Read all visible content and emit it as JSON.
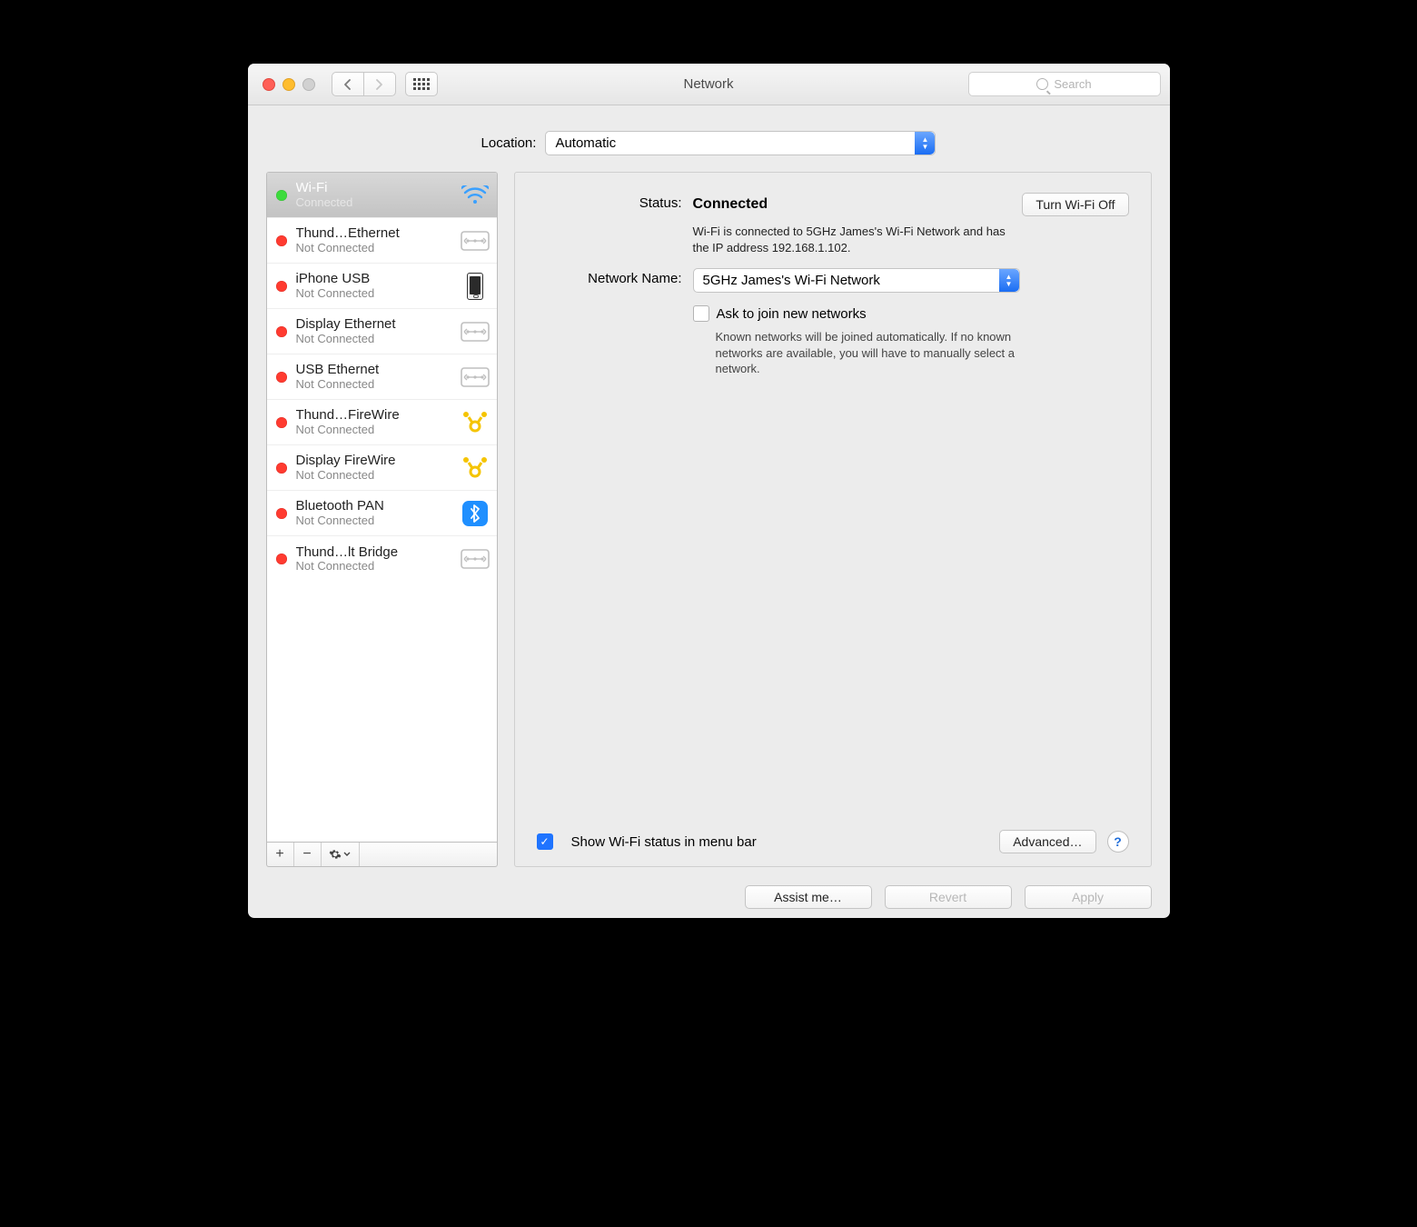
{
  "window": {
    "title": "Network"
  },
  "search": {
    "placeholder": "Search"
  },
  "location": {
    "label": "Location:",
    "value": "Automatic"
  },
  "services": [
    {
      "name": "Wi-Fi",
      "status": "Connected",
      "dot": "green",
      "icon": "wifi",
      "selected": true
    },
    {
      "name": "Thund…Ethernet",
      "status": "Not Connected",
      "dot": "red",
      "icon": "ethernet",
      "selected": false
    },
    {
      "name": "iPhone USB",
      "status": "Not Connected",
      "dot": "red",
      "icon": "iphone",
      "selected": false
    },
    {
      "name": "Display Ethernet",
      "status": "Not Connected",
      "dot": "red",
      "icon": "ethernet",
      "selected": false
    },
    {
      "name": "USB Ethernet",
      "status": "Not Connected",
      "dot": "red",
      "icon": "ethernet",
      "selected": false
    },
    {
      "name": "Thund…FireWire",
      "status": "Not Connected",
      "dot": "red",
      "icon": "firewire",
      "selected": false
    },
    {
      "name": "Display FireWire",
      "status": "Not Connected",
      "dot": "red",
      "icon": "firewire",
      "selected": false
    },
    {
      "name": "Bluetooth PAN",
      "status": "Not Connected",
      "dot": "red",
      "icon": "bluetooth",
      "selected": false
    },
    {
      "name": "Thund…lt Bridge",
      "status": "Not Connected",
      "dot": "red",
      "icon": "ethernet",
      "selected": false
    }
  ],
  "detail": {
    "status_label": "Status:",
    "status_value": "Connected",
    "toggle_button": "Turn Wi-Fi Off",
    "status_desc": "Wi-Fi is connected to 5GHz James's Wi-Fi Network and has the IP address 192.168.1.102.",
    "network_label": "Network Name:",
    "network_value": "5GHz James's Wi-Fi Network",
    "ask_label": "Ask to join new networks",
    "ask_desc": "Known networks will be joined automatically. If no known networks are available, you will have to manually select a network.",
    "show_menu_label": "Show Wi-Fi status in menu bar",
    "advanced_button": "Advanced…"
  },
  "footer": {
    "assist": "Assist me…",
    "revert": "Revert",
    "apply": "Apply"
  }
}
